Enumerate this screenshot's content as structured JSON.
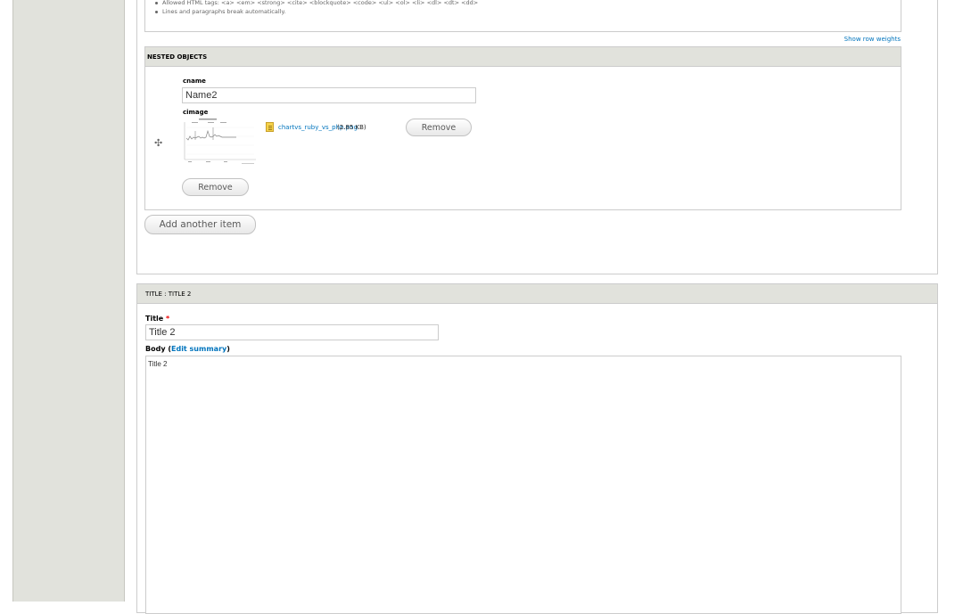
{
  "tips": [
    "Allowed HTML tags: <a> <em> <strong> <cite> <blockquote> <code> <ul> <ol> <li> <dl> <dt> <dd>",
    "Lines and paragraphs break automatically."
  ],
  "row_weights_link": "Show row weights",
  "nested": {
    "header": "NESTED OBJECTS",
    "cname_label": "cname",
    "cname_value": "Name2",
    "cimage_label": "cimage",
    "file_name": "chartvs_ruby_vs_php.png",
    "file_size": "(2.85 KB)",
    "file_remove_label": "Remove",
    "item_remove_label": "Remove"
  },
  "add_another_label": "Add another item",
  "edit": {
    "header": "TITLE : TITLE 2",
    "title_label": "Title",
    "required_marker": "*",
    "title_value": "Title 2",
    "body_label": "Body",
    "body_paren_open": " (",
    "edit_summary_link": "Edit summary",
    "body_paren_close": ")",
    "body_value": "Title 2"
  },
  "icons": {
    "drag": "drag-handle-icon",
    "file": "image-file-icon"
  },
  "colors": {
    "link": "#0074bd",
    "header_bg": "#e1e2dc",
    "required": "#ee0000"
  }
}
